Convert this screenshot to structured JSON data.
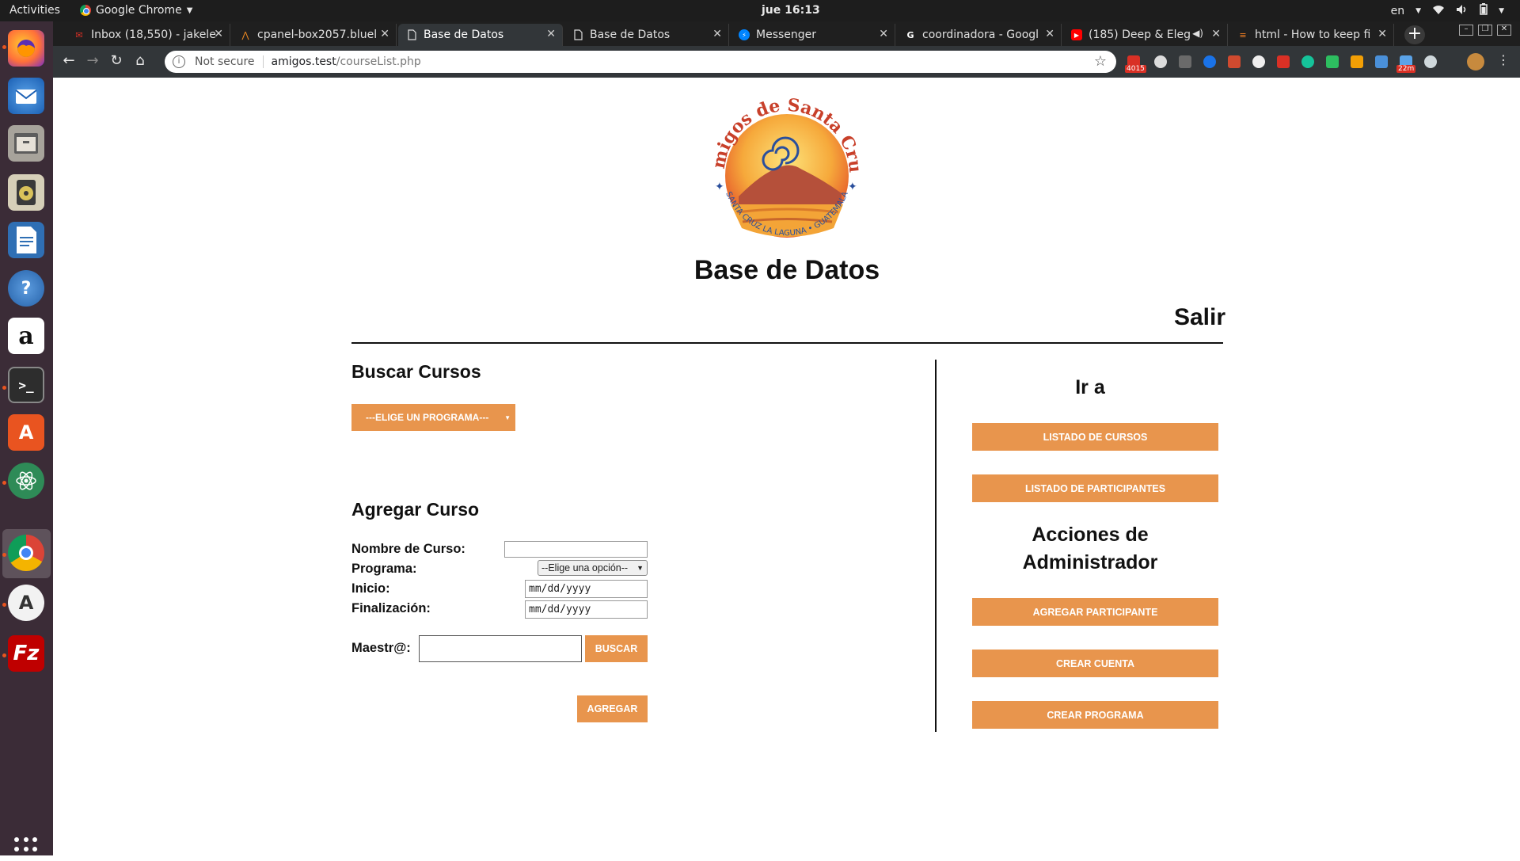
{
  "topbar": {
    "activities": "Activities",
    "app_name": "Google Chrome",
    "clock": "jue 16:13",
    "lang": "en"
  },
  "tabs": [
    {
      "title": "Inbox (18,550) - jakele",
      "favicon": "gmail-icon"
    },
    {
      "title": "cpanel-box2057.bluel",
      "favicon": "cpanel-icon"
    },
    {
      "title": "Base de Datos",
      "favicon": "page-icon"
    },
    {
      "title": "Base de Datos",
      "favicon": "page-icon"
    },
    {
      "title": "Messenger",
      "favicon": "messenger-icon"
    },
    {
      "title": "coordinadora - Googl",
      "favicon": "google-icon"
    },
    {
      "title": "(185) Deep & Eleg",
      "favicon": "youtube-icon"
    },
    {
      "title": "html - How to keep fi",
      "favicon": "stackoverflow-icon"
    }
  ],
  "toolbar": {
    "not_secure": "Not secure",
    "url_host": "amigos.test",
    "url_path": "/courseList.php",
    "gmail_badge": "4015",
    "timer_badge": "22m"
  },
  "page": {
    "logo_text_top": "Amigos de Santa Cruz",
    "logo_text_bottom": "SANTA CRUZ LA LAGUNA • GUATEMALA",
    "site_title": "Base de Datos",
    "logout": "Salir",
    "search": {
      "heading": "Buscar Cursos",
      "program_select": "---ELIGE UN PROGRAMA---"
    },
    "add_course": {
      "heading": "Agregar Curso",
      "name_label": "Nombre de Curso:",
      "program_label": "Programa:",
      "program_select": "--Elige una opción--",
      "start_label": "Inicio:",
      "start_placeholder": "mm/dd/yyyy",
      "end_label": "Finalización:",
      "end_placeholder": "mm/dd/yyyy",
      "teacher_label": "Maestr@:",
      "search_button": "BUSCAR",
      "add_button": "AGREGAR"
    },
    "sidebar": {
      "goto_heading": "Ir a",
      "course_list": "LISTADO DE CURSOS",
      "participant_list": "LISTADO DE PARTICIPANTES",
      "admin_heading_1": "Acciones de",
      "admin_heading_2": "Administrador",
      "add_participant": "AGREGAR PARTICIPANTE",
      "create_account": "CREAR CUENTA",
      "create_program": "CREAR PROGRAMA"
    }
  },
  "colors": {
    "accent": "#e8954d",
    "dock": "#3b2c37",
    "tabstrip": "#1f1f1f",
    "toolbar": "#323639"
  }
}
